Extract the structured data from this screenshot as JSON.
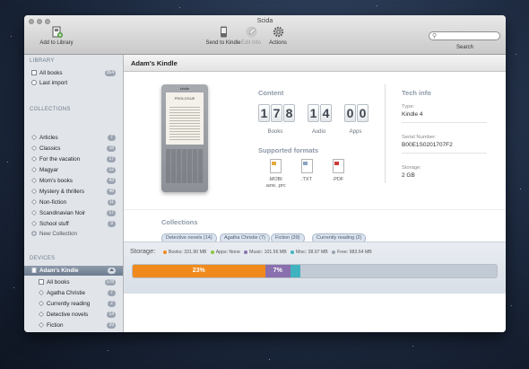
{
  "window": {
    "title": "Scida"
  },
  "toolbar": {
    "add_to_library": "Add to Library",
    "send_to_kindle": "Send to Kindle",
    "edit_info": "Edit Info",
    "actions": "Actions",
    "search_label": "Search"
  },
  "sidebar": {
    "library_header": "LIBRARY",
    "library": [
      {
        "label": "All books",
        "count": "364"
      },
      {
        "label": "Last import",
        "count": ""
      }
    ],
    "collections_header": "COLLECTIONS",
    "collections": [
      {
        "label": "Articles",
        "count": "7"
      },
      {
        "label": "Classics",
        "count": "18"
      },
      {
        "label": "For the vacation",
        "count": "17"
      },
      {
        "label": "Magyar",
        "count": "12"
      },
      {
        "label": "Mom's books",
        "count": "43"
      },
      {
        "label": "Mystery & thrillers",
        "count": "48"
      },
      {
        "label": "Non-fiction",
        "count": "11"
      },
      {
        "label": "Scandinavian Noir",
        "count": "17"
      },
      {
        "label": "School stuff",
        "count": "9"
      }
    ],
    "new_collection": "New Collection",
    "devices_header": "DEVICES",
    "device": {
      "label": "Adam's Kindle",
      "count": ""
    },
    "device_items": [
      {
        "label": "All books",
        "count": "178"
      },
      {
        "label": "Agatha Christie",
        "count": "7"
      },
      {
        "label": "Currently reading",
        "count": "2"
      },
      {
        "label": "Detective novels",
        "count": "14"
      },
      {
        "label": "Fiction",
        "count": "39"
      }
    ]
  },
  "main": {
    "title": "Adam's Kindle",
    "kindle_brand": "kindle",
    "kindle_page_header": "PROLOGUE",
    "content_title": "Content",
    "books_digits": [
      "1",
      "7",
      "8"
    ],
    "audio_digits": [
      "1",
      "4"
    ],
    "apps_digits": [
      "0",
      "0"
    ],
    "books_label": "Books",
    "audio_label": "Audio",
    "apps_label": "Apps",
    "formats_title": "Supported formats",
    "formats": [
      {
        "name": ".MOBI",
        "sub": ".azw, .prc",
        "color": "#e2a93b"
      },
      {
        "name": ".TXT",
        "sub": "",
        "color": "#8aa3c2"
      },
      {
        "name": ".PDF",
        "sub": "",
        "color": "#cc3b3b"
      }
    ],
    "tech_title": "Tech info",
    "type_label": "Type:",
    "type_value": "Kindle 4",
    "serial_label": "Serial Number:",
    "serial_value": "B00E1S0201707F2",
    "storage_label": "Storage:",
    "storage_value": "2 GB",
    "collections_title": "Collections",
    "collection_tags": [
      "Detective novels (14)",
      "Agatha Christie (7)",
      "Fiction (39)",
      "Currently reading (2)"
    ]
  },
  "storage": {
    "label": "Storage:",
    "legend": [
      {
        "text": "Books: 331.90 MB",
        "color": "#f08a1c"
      },
      {
        "text": "Apps: None",
        "color": "#8cc63f"
      },
      {
        "text": "Music: 101.56 MB",
        "color": "#8a6fae"
      },
      {
        "text": "Misc: 38.97 MB",
        "color": "#3fb4c0"
      },
      {
        "text": "Free: 983.64 MB",
        "color": "#9aa3af"
      }
    ],
    "books_pct_label": "23%",
    "music_pct_label": "7%",
    "books_pct": 23,
    "music_pct": 7,
    "misc_pct": 2.7
  }
}
